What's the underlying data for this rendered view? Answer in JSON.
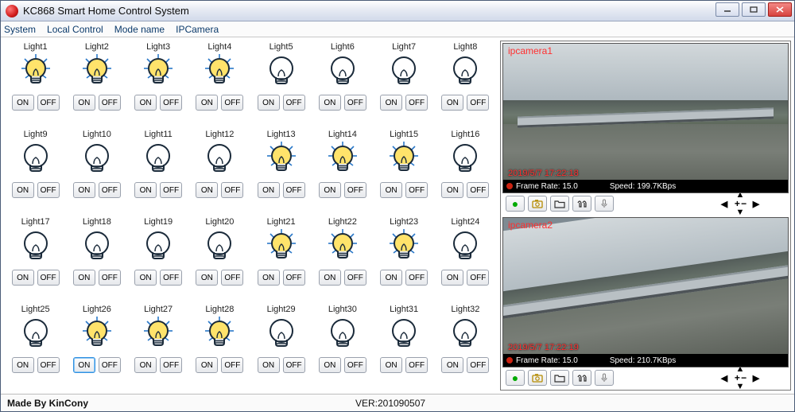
{
  "window": {
    "title": "KC868 Smart Home Control System"
  },
  "menu": {
    "items": [
      "System",
      "Local Control",
      "Mode name",
      "IPCamera"
    ]
  },
  "buttons": {
    "on": "ON",
    "off": "OFF"
  },
  "lights": [
    {
      "label": "Light1",
      "on": true
    },
    {
      "label": "Light2",
      "on": true
    },
    {
      "label": "Light3",
      "on": true
    },
    {
      "label": "Light4",
      "on": true
    },
    {
      "label": "Light5",
      "on": false
    },
    {
      "label": "Light6",
      "on": false
    },
    {
      "label": "Light7",
      "on": false
    },
    {
      "label": "Light8",
      "on": false
    },
    {
      "label": "Light9",
      "on": false
    },
    {
      "label": "Light10",
      "on": false
    },
    {
      "label": "Light11",
      "on": false
    },
    {
      "label": "Light12",
      "on": false
    },
    {
      "label": "Light13",
      "on": true
    },
    {
      "label": "Light14",
      "on": true
    },
    {
      "label": "Light15",
      "on": true
    },
    {
      "label": "Light16",
      "on": false
    },
    {
      "label": "Light17",
      "on": false
    },
    {
      "label": "Light18",
      "on": false
    },
    {
      "label": "Light19",
      "on": false
    },
    {
      "label": "Light20",
      "on": false
    },
    {
      "label": "Light21",
      "on": true
    },
    {
      "label": "Light22",
      "on": true
    },
    {
      "label": "Light23",
      "on": true
    },
    {
      "label": "Light24",
      "on": false
    },
    {
      "label": "Light25",
      "on": false
    },
    {
      "label": "Light26",
      "on": true,
      "highlight": true
    },
    {
      "label": "Light27",
      "on": true
    },
    {
      "label": "Light28",
      "on": true
    },
    {
      "label": "Light29",
      "on": false
    },
    {
      "label": "Light30",
      "on": false
    },
    {
      "label": "Light31",
      "on": false
    },
    {
      "label": "Light32",
      "on": false
    }
  ],
  "cameras": [
    {
      "name": "ipcamera1",
      "timestamp": "2019/5/7 17:22:18",
      "frame_rate_label": "Frame Rate:",
      "frame_rate": "15.0",
      "speed_label": "Speed:",
      "speed": "199.7KBps"
    },
    {
      "name": "ipcamera2",
      "timestamp": "2019/5/7 17:22:19",
      "frame_rate_label": "Frame Rate:",
      "frame_rate": "15.0",
      "speed_label": "Speed:",
      "speed": "210.7KBps"
    }
  ],
  "statusbar": {
    "made_by": "Made By KinCony",
    "version": "VER:201090507"
  }
}
